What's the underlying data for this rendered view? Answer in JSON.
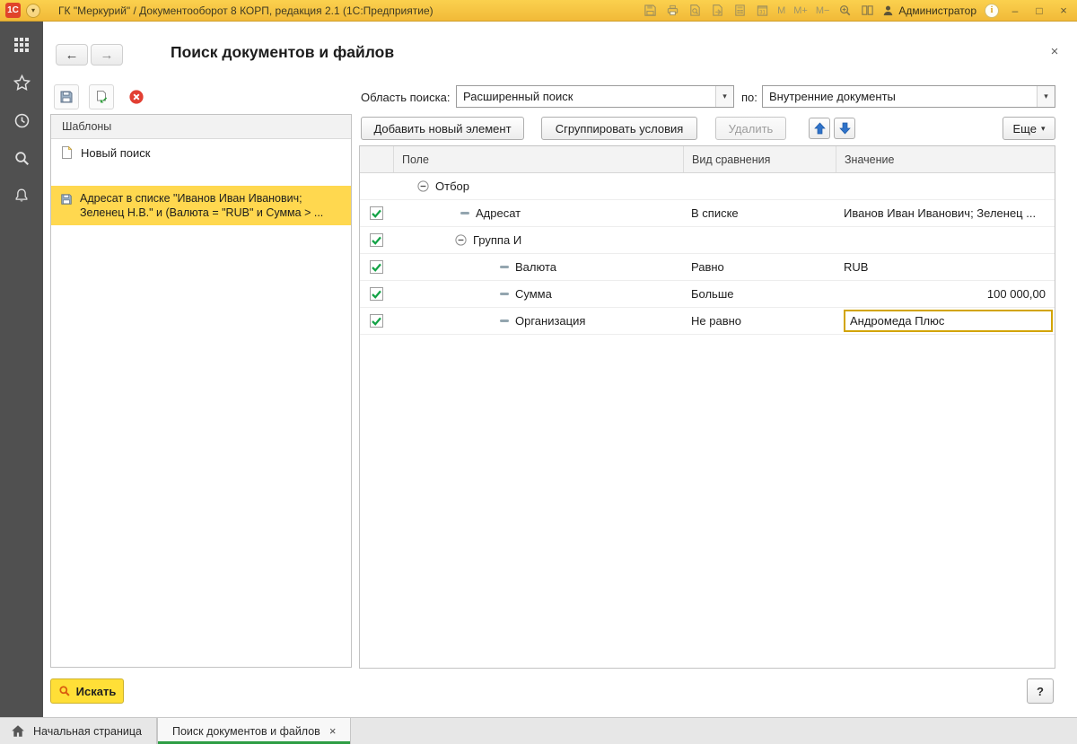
{
  "titlebar": {
    "logo_text": "1С",
    "title": "ГК \"Меркурий\" / Документооборот 8 КОРП, редакция 2.1 (1С:Предприятие)",
    "memory": [
      "M",
      "M+",
      "M−"
    ],
    "user": "Администратор",
    "info_glyph": "i",
    "win_min": "–",
    "win_max": "□",
    "win_close": "×"
  },
  "nav": {
    "back": "←",
    "forward": "→"
  },
  "page": {
    "title": "Поиск документов и файлов",
    "close": "×"
  },
  "templates": {
    "header": "Шаблоны",
    "new_item": "Новый поиск",
    "selected_item": "Адресат в списке \"Иванов Иван Иванович; Зеленец Н.В.\" и (Валюта = \"RUB\" и Сумма > ..."
  },
  "controls": {
    "scope_label": "Область поиска:",
    "scope_value": "Расширенный поиск",
    "by_label": "по:",
    "by_value": "Внутренние документы",
    "add_button": "Добавить новый элемент",
    "group_button": "Сгруппировать условия",
    "delete_button": "Удалить",
    "more_button": "Еще",
    "dropdown_glyph": "▾"
  },
  "table": {
    "col_field": "Поле",
    "col_comparison": "Вид сравнения",
    "col_value": "Значение",
    "rows": [
      {
        "type": "group",
        "label": "Отбор"
      },
      {
        "type": "condition",
        "checked": true,
        "field": "Адресат",
        "comparison": "В списке",
        "value": "Иванов Иван Иванович; Зеленец ..."
      },
      {
        "type": "group",
        "checked": true,
        "label": "Группа И"
      },
      {
        "type": "condition",
        "checked": true,
        "field": "Валюта",
        "comparison": "Равно",
        "value": "RUB"
      },
      {
        "type": "condition",
        "checked": true,
        "field": "Сумма",
        "comparison": "Больше",
        "value": "100 000,00"
      },
      {
        "type": "condition",
        "checked": true,
        "field": "Организация",
        "comparison": "Не равно",
        "value": "Андромеда Плюс"
      }
    ]
  },
  "footer": {
    "search_button": "Искать",
    "help_button": "?"
  },
  "tabs": [
    {
      "label": "Начальная страница"
    },
    {
      "label": "Поиск документов и файлов",
      "close": "×",
      "active": true
    }
  ],
  "colors": {
    "titlebar": "#f7c844",
    "selection": "#ffd84f",
    "accent_green": "#2e9e44",
    "edit_border": "#d2a400",
    "check_green": "#14a347"
  }
}
